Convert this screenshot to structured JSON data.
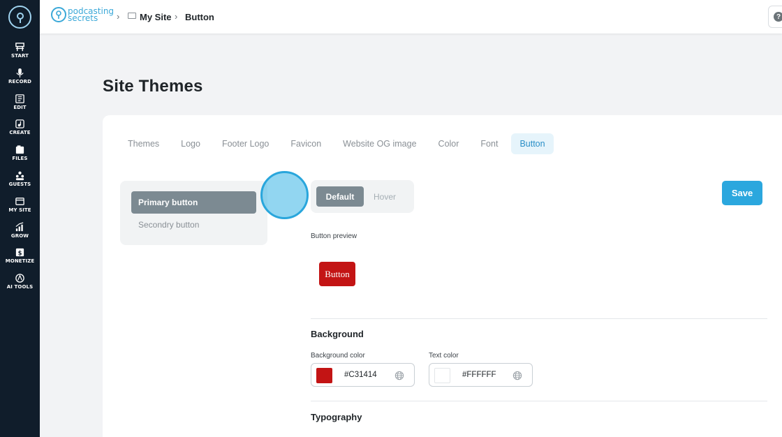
{
  "sidebar": {
    "items": [
      {
        "label": "START",
        "icon": "start-icon"
      },
      {
        "label": "RECORD",
        "icon": "microphone-icon"
      },
      {
        "label": "EDIT",
        "icon": "edit-icon"
      },
      {
        "label": "CREATE",
        "icon": "create-icon"
      },
      {
        "label": "FILES",
        "icon": "files-icon"
      },
      {
        "label": "GUESTS",
        "icon": "guests-icon"
      },
      {
        "label": "MY SITE",
        "icon": "site-icon"
      },
      {
        "label": "GROW",
        "icon": "grow-icon"
      },
      {
        "label": "MONETIZE",
        "icon": "monetize-icon"
      },
      {
        "label": "AI TOOLS",
        "icon": "ai-tools-icon"
      }
    ]
  },
  "header": {
    "brand_line1": "podcasting",
    "brand_line2": "secrets",
    "breadcrumb": [
      "My Site",
      "Button"
    ],
    "help_symbol": "?"
  },
  "page": {
    "title": "Site Themes"
  },
  "tabs": [
    "Themes",
    "Logo",
    "Footer Logo",
    "Favicon",
    "Website OG image",
    "Color",
    "Font",
    "Button"
  ],
  "active_tab": "Button",
  "button_types": [
    "Primary button",
    "Secondry button"
  ],
  "state_toggle": {
    "default": "Default",
    "hover": "Hover"
  },
  "save_label": "Save",
  "preview": {
    "label": "Button preview",
    "button_text": "Button"
  },
  "background": {
    "title": "Background",
    "bg_color_label": "Background color",
    "bg_color_value": "#C31414",
    "text_color_label": "Text color",
    "text_color_value": "#FFFFFF"
  },
  "typography": {
    "title": "Typography"
  },
  "colors": {
    "accent": "#2ba7de",
    "sidebar_bg": "#101d2b",
    "preview_bg": "#C31414"
  }
}
